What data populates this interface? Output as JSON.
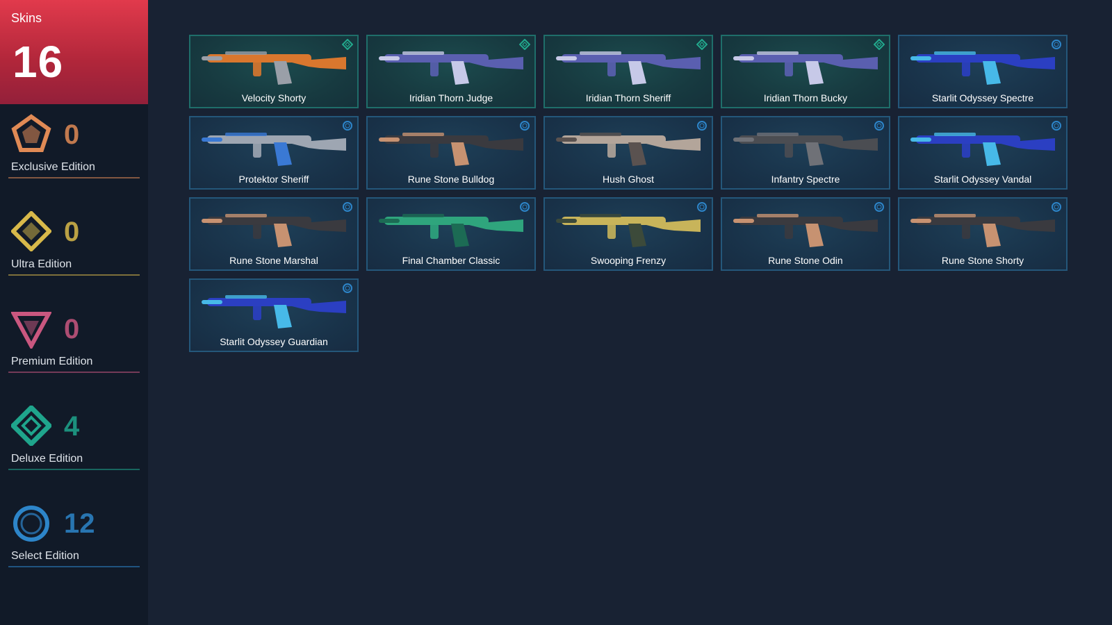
{
  "skins": {
    "title": "Skins",
    "count": "16"
  },
  "tiers": [
    {
      "label": "Exclusive Edition",
      "count": "0",
      "color": "#e08a55",
      "icon": "exclusive-tier-icon"
    },
    {
      "label": "Ultra Edition",
      "count": "0",
      "color": "#d8b94a",
      "icon": "ultra-tier-icon"
    },
    {
      "label": "Premium Edition",
      "count": "0",
      "color": "#c9577f",
      "icon": "premium-tier-icon"
    },
    {
      "label": "Deluxe Edition",
      "count": "4",
      "color": "#1fa58c",
      "icon": "deluxe-tier-icon"
    },
    {
      "label": "Select Edition",
      "count": "12",
      "color": "#2d85c9",
      "icon": "select-tier-icon"
    }
  ],
  "cards": [
    {
      "name": "Velocity Shorty",
      "tier": "deluxe",
      "colors": [
        "#d9772e",
        "#9a9fa8"
      ]
    },
    {
      "name": "Iridian Thorn Judge",
      "tier": "deluxe",
      "colors": [
        "#5a5fb0",
        "#c7c9e8"
      ]
    },
    {
      "name": "Iridian Thorn Sheriff",
      "tier": "deluxe",
      "colors": [
        "#5a5fb0",
        "#c7c9e8"
      ]
    },
    {
      "name": "Iridian Thorn Bucky",
      "tier": "deluxe",
      "colors": [
        "#5a5fb0",
        "#c7c9e8"
      ]
    },
    {
      "name": "Starlit Odyssey Spectre",
      "tier": "select",
      "colors": [
        "#2b3fc2",
        "#47b9e8"
      ]
    },
    {
      "name": "Protektor Sheriff",
      "tier": "select",
      "colors": [
        "#9ea6b2",
        "#3a79d4"
      ]
    },
    {
      "name": "Rune Stone Bulldog",
      "tier": "select",
      "colors": [
        "#3a3a3f",
        "#c79271"
      ]
    },
    {
      "name": "Hush Ghost",
      "tier": "select",
      "colors": [
        "#b3a59a",
        "#5a5250"
      ]
    },
    {
      "name": "Infantry Spectre",
      "tier": "select",
      "colors": [
        "#4b4d52",
        "#6f7177"
      ]
    },
    {
      "name": "Starlit Odyssey Vandal",
      "tier": "select",
      "colors": [
        "#2b3fc2",
        "#47b9e8"
      ]
    },
    {
      "name": "Rune Stone Marshal",
      "tier": "select",
      "colors": [
        "#3a3a3f",
        "#c79271"
      ]
    },
    {
      "name": "Final Chamber Classic",
      "tier": "select",
      "colors": [
        "#2fa57d",
        "#1c6b54"
      ]
    },
    {
      "name": "Swooping Frenzy",
      "tier": "select",
      "colors": [
        "#c8b45a",
        "#3c4a3a"
      ]
    },
    {
      "name": "Rune Stone Odin",
      "tier": "select",
      "colors": [
        "#3a3a3f",
        "#c79271"
      ]
    },
    {
      "name": "Rune Stone Shorty",
      "tier": "select",
      "colors": [
        "#3a3a3f",
        "#c79271"
      ]
    },
    {
      "name": "Starlit Odyssey Guardian",
      "tier": "select",
      "colors": [
        "#2b3fc2",
        "#47b9e8"
      ]
    }
  ]
}
